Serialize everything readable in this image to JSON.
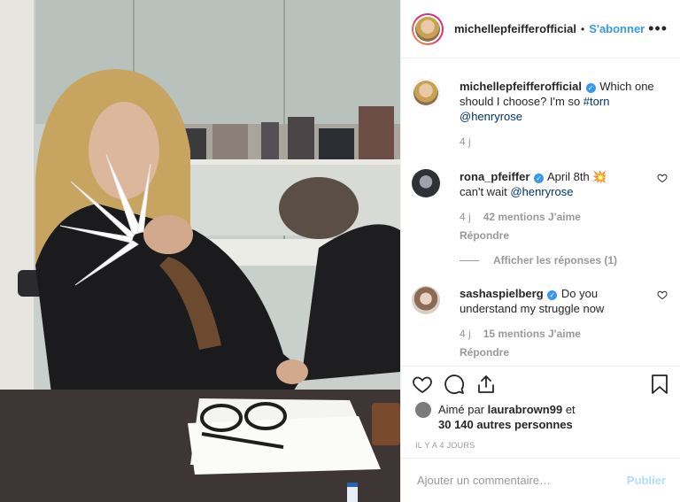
{
  "post": {
    "username": "michellepfeifferofficial",
    "follow_label": "S'abonner",
    "more_label": "•••"
  },
  "caption": {
    "username": "michellepfeifferofficial",
    "text_before": "Which one should I choose? I'm so",
    "hashtag": "#torn",
    "mention": "@henryrose",
    "time": "4 j"
  },
  "comments": [
    {
      "username": "rona_pfeiffer",
      "text_before": "April 8th",
      "emoji": "💥",
      "text_after": "can't wait",
      "mention": "@henryrose",
      "time": "4 j",
      "likes": "42 mentions J'aime",
      "reply": "Répondre"
    },
    {
      "username": "sashaspielberg",
      "text": "Do you understand my struggle now",
      "time": "4 j",
      "likes": "15 mentions J'aime",
      "reply": "Répondre"
    }
  ],
  "thread": {
    "label": "Afficher les réponses (1)"
  },
  "likes_line": {
    "prefix": "Aimé par",
    "user": "laurabrown99",
    "connector": "et",
    "others": "30 140 autres personnes"
  },
  "timestamp": "IL Y A 4 JOURS",
  "add_comment": {
    "placeholder": "Ajouter un commentaire…",
    "publish": "Publier"
  },
  "colors": {
    "accent": "#3897f0",
    "publish_disabled": "#b2dffc",
    "muted": "#999999"
  }
}
